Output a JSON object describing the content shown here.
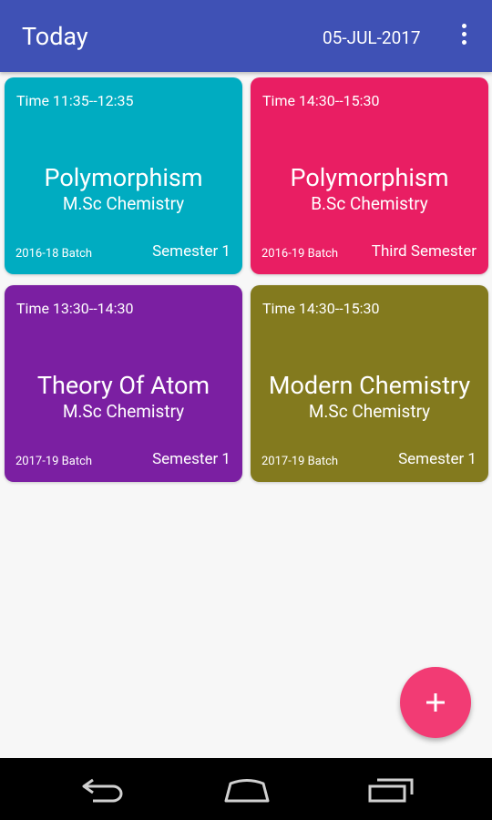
{
  "app_bar": {
    "title": "Today",
    "date": "05-JUL-2017",
    "menu_icon": "more-vert-icon"
  },
  "cards": [
    {
      "time": "Time 11:35--12:35",
      "subject": "Polymorphism",
      "course": "M.Sc Chemistry",
      "batch": "2016-18 Batch",
      "semester": "Semester 1",
      "color": "#00acc1"
    },
    {
      "time": "Time 14:30--15:30",
      "subject": "Polymorphism",
      "course": "B.Sc Chemistry",
      "batch": "2016-19 Batch",
      "semester": "Third Semester",
      "color": "#e91e63"
    },
    {
      "time": "Time 13:30--14:30",
      "subject": "Theory Of Atom",
      "course": "M.Sc Chemistry",
      "batch": "2017-19 Batch",
      "semester": "Semester 1",
      "color": "#7b1fa2"
    },
    {
      "time": "Time 14:30--15:30",
      "subject": "Modern Chemistry",
      "course": "M.Sc Chemistry",
      "batch": "2017-19 Batch",
      "semester": "Semester 1",
      "color": "#837a1e"
    }
  ],
  "fab": {
    "icon": "add-icon",
    "color": "#f23b74"
  },
  "nav_bar": {
    "icons": [
      "back-icon",
      "home-icon",
      "recent-apps-icon"
    ]
  }
}
